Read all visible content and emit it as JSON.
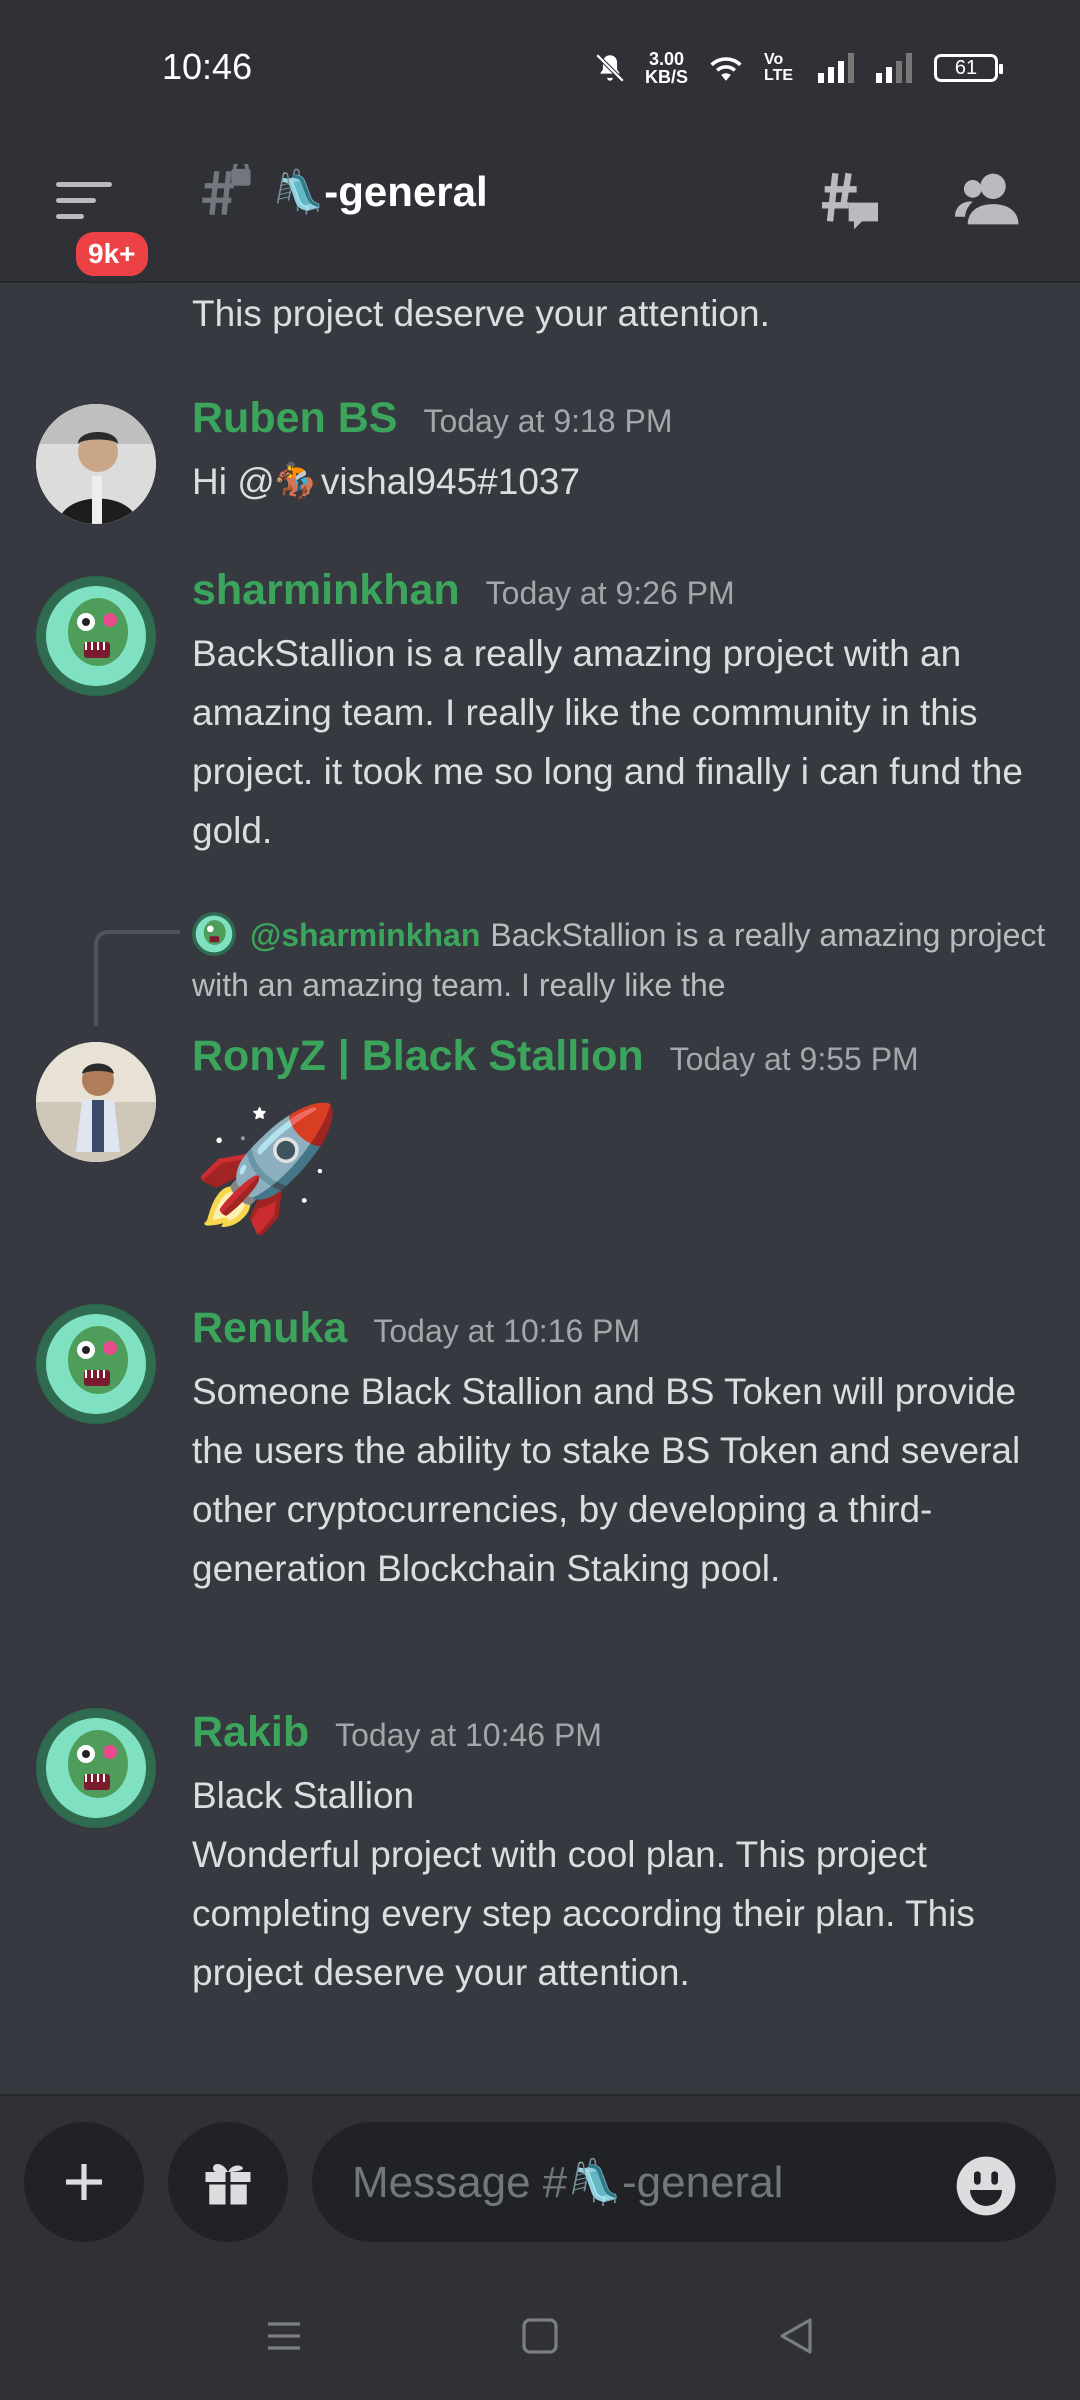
{
  "status_bar": {
    "time": "10:46",
    "speed_value": "3.00",
    "speed_unit": "KB/S",
    "network_label": "Vo LTE",
    "battery": "61"
  },
  "header": {
    "badge": "9k+",
    "channel_name": "🛝-general"
  },
  "messages": {
    "partial_top": "This project deserve your attention.",
    "items": [
      {
        "username": "Ruben BS",
        "timestamp": "Today at 9:18 PM",
        "text": "Hi @🏇vishal945#1037"
      },
      {
        "username": "sharminkhan",
        "timestamp": "Today at 9:26 PM",
        "text": "BackStallion is a really amazing project with an amazing team. I really like the community in this project. it took me so long and finally i can fund the gold."
      },
      {
        "username": "RonyZ | Black Stallion",
        "timestamp": "Today at 9:55 PM",
        "text": "🚀",
        "reply_mention": "@sharminkhan",
        "reply_text": "BackStallion is a really amazing project with an amazing team. I really like the"
      },
      {
        "username": "Renuka",
        "timestamp": "Today at 10:16 PM",
        "text": "Someone Black Stallion and BS Token will provide the users the ability to stake BS Token and several other cryptocurrencies, by developing a third-generation Blockchain Staking pool."
      },
      {
        "username": "Rakib",
        "timestamp": "Today at 10:46 PM",
        "text_line1": "Black Stallion",
        "text": "Wonderful project with cool plan. This project completing every step according their plan. This project deserve your attention."
      }
    ]
  },
  "composer": {
    "placeholder": "Message #🛝-general"
  },
  "colors": {
    "background": "#36393f",
    "username": "#3ba55c",
    "badge": "#ed4245"
  }
}
